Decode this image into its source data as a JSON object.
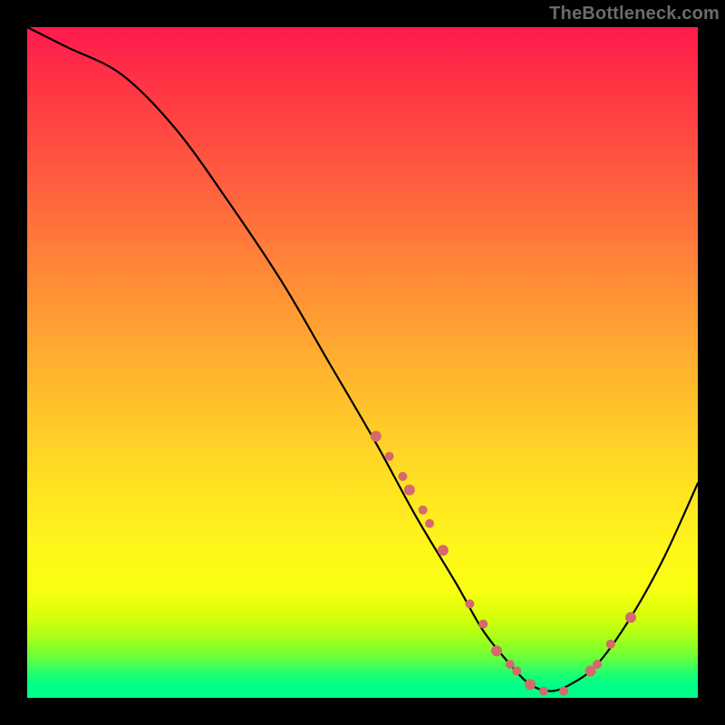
{
  "watermark": "TheBottleneck.com",
  "chart_data": {
    "type": "line",
    "title": "",
    "xlabel": "",
    "ylabel": "",
    "xlim": [
      0,
      100
    ],
    "ylim": [
      0,
      100
    ],
    "series": [
      {
        "name": "bottleneck-curve",
        "x": [
          0,
          6,
          14,
          22,
          30,
          38,
          45,
          52,
          58,
          64,
          68,
          72,
          75,
          78,
          81,
          85,
          90,
          95,
          100
        ],
        "y": [
          100,
          97,
          93,
          85,
          74,
          62,
          50,
          38,
          27,
          17,
          10,
          5,
          2,
          1,
          2,
          5,
          12,
          21,
          32
        ]
      }
    ],
    "markers": {
      "name": "highlight-points",
      "color": "#d46a6a",
      "x": [
        52,
        54,
        56,
        57,
        59,
        60,
        62,
        66,
        68,
        70,
        72,
        73,
        75,
        77,
        80,
        84,
        85,
        87,
        90
      ],
      "y": [
        39,
        36,
        33,
        31,
        28,
        26,
        22,
        14,
        11,
        7,
        5,
        4,
        2,
        1,
        1,
        4,
        5,
        8,
        12
      ]
    },
    "gradient_stops": [
      {
        "pct": 0,
        "color": "#ff1a4d"
      },
      {
        "pct": 20,
        "color": "#ff5540"
      },
      {
        "pct": 44,
        "color": "#ff9e33"
      },
      {
        "pct": 68,
        "color": "#ffe123"
      },
      {
        "pct": 88,
        "color": "#d6ff0a"
      },
      {
        "pct": 100,
        "color": "#00ff88"
      }
    ]
  }
}
